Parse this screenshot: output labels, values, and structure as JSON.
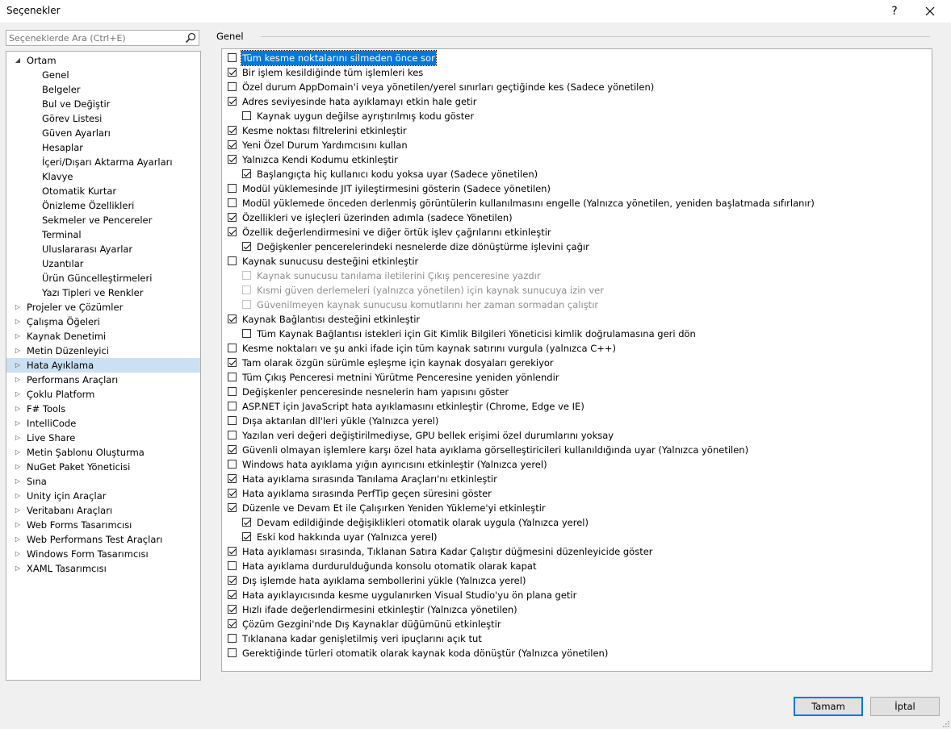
{
  "window": {
    "title": "Seçenekler",
    "help_label": "?"
  },
  "search": {
    "placeholder": "Seçeneklerde Ara (Ctrl+E)"
  },
  "tree": [
    {
      "label": "Ortam",
      "level": 0,
      "expanded": true
    },
    {
      "label": "Genel",
      "level": 1
    },
    {
      "label": "Belgeler",
      "level": 1
    },
    {
      "label": "Bul ve Değiştir",
      "level": 1
    },
    {
      "label": "Görev Listesi",
      "level": 1
    },
    {
      "label": "Güven Ayarları",
      "level": 1
    },
    {
      "label": "Hesaplar",
      "level": 1
    },
    {
      "label": "İçeri/Dışarı Aktarma Ayarları",
      "level": 1
    },
    {
      "label": "Klavye",
      "level": 1
    },
    {
      "label": "Otomatik Kurtar",
      "level": 1
    },
    {
      "label": "Önizleme Özellikleri",
      "level": 1
    },
    {
      "label": "Sekmeler ve Pencereler",
      "level": 1
    },
    {
      "label": "Terminal",
      "level": 1
    },
    {
      "label": "Uluslararası Ayarlar",
      "level": 1
    },
    {
      "label": "Uzantılar",
      "level": 1
    },
    {
      "label": "Ürün Güncelleştirmeleri",
      "level": 1
    },
    {
      "label": "Yazı Tipleri ve Renkler",
      "level": 1
    },
    {
      "label": "Projeler ve Çözümler",
      "level": 0,
      "expanded": false
    },
    {
      "label": "Çalışma Öğeleri",
      "level": 0,
      "expanded": false
    },
    {
      "label": "Kaynak Denetimi",
      "level": 0,
      "expanded": false
    },
    {
      "label": "Metin Düzenleyici",
      "level": 0,
      "expanded": false
    },
    {
      "label": "Hata Ayıklama",
      "level": 0,
      "expanded": false,
      "selected": true
    },
    {
      "label": "Performans Araçları",
      "level": 0,
      "expanded": false
    },
    {
      "label": "Çoklu Platform",
      "level": 0,
      "expanded": false
    },
    {
      "label": "F# Tools",
      "level": 0,
      "expanded": false
    },
    {
      "label": "IntelliCode",
      "level": 0,
      "expanded": false
    },
    {
      "label": "Live Share",
      "level": 0,
      "expanded": false
    },
    {
      "label": "Metin Şablonu Oluşturma",
      "level": 0,
      "expanded": false
    },
    {
      "label": "NuGet Paket Yöneticisi",
      "level": 0,
      "expanded": false
    },
    {
      "label": "Sına",
      "level": 0,
      "expanded": false
    },
    {
      "label": "Unity için Araçlar",
      "level": 0,
      "expanded": false
    },
    {
      "label": "Veritabanı Araçları",
      "level": 0,
      "expanded": false
    },
    {
      "label": "Web Forms Tasarımcısı",
      "level": 0,
      "expanded": false
    },
    {
      "label": "Web Performans Test Araçları",
      "level": 0,
      "expanded": false
    },
    {
      "label": "Windows Form Tasarımcısı",
      "level": 0,
      "expanded": false
    },
    {
      "label": "XAML Tasarımcısı",
      "level": 0,
      "expanded": false
    }
  ],
  "section": {
    "title": "Genel"
  },
  "options": [
    {
      "label": "Tüm kesme noktalarını silmeden önce sor",
      "checked": false,
      "indent": 0,
      "focused": true
    },
    {
      "label": "Bir işlem kesildiğinde tüm işlemleri kes",
      "checked": true,
      "indent": 0
    },
    {
      "label": "Özel durum AppDomain'i veya yönetilen/yerel sınırları geçtiğinde kes (Sadece yönetilen)",
      "checked": false,
      "indent": 0
    },
    {
      "label": "Adres seviyesinde hata ayıklamayı etkin hale getir",
      "checked": true,
      "indent": 0
    },
    {
      "label": "Kaynak uygun değilse ayrıştırılmış kodu göster",
      "checked": false,
      "indent": 1
    },
    {
      "label": "Kesme noktası filtrelerini etkinleştir",
      "checked": true,
      "indent": 0
    },
    {
      "label": "Yeni Özel Durum Yardımcısını kullan",
      "checked": true,
      "indent": 0
    },
    {
      "label": "Yalnızca Kendi Kodumu etkinleştir",
      "checked": true,
      "indent": 0
    },
    {
      "label": "Başlangıçta hiç kullanıcı kodu yoksa uyar (Sadece yönetilen)",
      "checked": true,
      "indent": 1
    },
    {
      "label": "Modül yüklemesinde JIT iyileştirmesini gösterin (Sadece yönetilen)",
      "checked": false,
      "indent": 0
    },
    {
      "label": "Modül yüklemede önceden derlenmiş görüntülerin kullanılmasını engelle (Yalnızca yönetilen, yeniden başlatmada sıfırlanır)",
      "checked": false,
      "indent": 0
    },
    {
      "label": "Özellikleri ve işleçleri üzerinden adımla (sadece Yönetilen)",
      "checked": true,
      "indent": 0
    },
    {
      "label": "Özellik değerlendirmesini ve diğer örtük işlev çağrılarını etkinleştir",
      "checked": true,
      "indent": 0
    },
    {
      "label": "Değişkenler pencerelerindeki nesnelerde dize dönüştürme işlevini çağır",
      "checked": true,
      "indent": 1
    },
    {
      "label": "Kaynak sunucusu desteğini etkinleştir",
      "checked": false,
      "indent": 0
    },
    {
      "label": "Kaynak sunucusu tanılama iletilerini Çıkış penceresine yazdır",
      "checked": false,
      "indent": 1,
      "disabled": true
    },
    {
      "label": "Kısmi güven derlemeleri (yalnızca yönetilen) için kaynak sunucuya izin ver",
      "checked": false,
      "indent": 1,
      "disabled": true
    },
    {
      "label": "Güvenilmeyen kaynak sunucusu komutlarını her zaman sormadan çalıştır",
      "checked": false,
      "indent": 1,
      "disabled": true
    },
    {
      "label": "Kaynak Bağlantısı desteğini etkinleştir",
      "checked": true,
      "indent": 0
    },
    {
      "label": "Tüm Kaynak Bağlantısı istekleri için Git Kimlik Bilgileri Yöneticisi kimlik doğrulamasına geri dön",
      "checked": false,
      "indent": 1
    },
    {
      "label": "Kesme noktaları ve şu anki ifade için tüm kaynak satırını vurgula (yalnızca C++)",
      "checked": false,
      "indent": 0
    },
    {
      "label": "Tam olarak özgün sürümle eşleşme için kaynak dosyaları gerekiyor",
      "checked": true,
      "indent": 0
    },
    {
      "label": "Tüm Çıkış Penceresi metnini Yürütme Penceresine yeniden yönlendir",
      "checked": false,
      "indent": 0
    },
    {
      "label": "Değişkenler penceresinde nesnelerin ham yapısını göster",
      "checked": false,
      "indent": 0
    },
    {
      "label": "ASP.NET için JavaScript hata ayıklamasını etkinleştir (Chrome, Edge ve IE)",
      "checked": false,
      "indent": 0
    },
    {
      "label": "Dışa aktarılan dll'leri yükle (Yalnızca yerel)",
      "checked": false,
      "indent": 0
    },
    {
      "label": "Yazılan veri değeri değiştirilmediyse, GPU bellek erişimi özel durumlarını yoksay",
      "checked": false,
      "indent": 0
    },
    {
      "label": "Güvenli olmayan işlemlere karşı özel hata ayıklama görselleştiricileri kullanıldığında uyar (Yalnızca yönetilen)",
      "checked": true,
      "indent": 0
    },
    {
      "label": "Windows hata ayıklama yığın ayırıcısını etkinleştir (Yalnızca yerel)",
      "checked": false,
      "indent": 0
    },
    {
      "label": "Hata ayıklama sırasında Tanılama Araçları'nı etkinleştir",
      "checked": true,
      "indent": 0
    },
    {
      "label": "Hata ayıklama sırasında PerfTip geçen süresini göster",
      "checked": true,
      "indent": 0
    },
    {
      "label": "Düzenle ve Devam Et ile Çalışırken Yeniden Yükleme'yi etkinleştir",
      "checked": true,
      "indent": 0
    },
    {
      "label": "Devam edildiğinde değişiklikleri otomatik olarak uygula (Yalnızca yerel)",
      "checked": true,
      "indent": 1
    },
    {
      "label": "Eski kod hakkında uyar (Yalnızca yerel)",
      "checked": true,
      "indent": 1
    },
    {
      "label": "Hata ayıklaması sırasında, Tıklanan Satıra Kadar Çalıştır düğmesini düzenleyicide göster",
      "checked": true,
      "indent": 0
    },
    {
      "label": "Hata ayıklama durdurulduğunda konsolu otomatik olarak kapat",
      "checked": false,
      "indent": 0
    },
    {
      "label": "Dış işlemde hata ayıklama sembollerini yükle (Yalnızca yerel)",
      "checked": true,
      "indent": 0
    },
    {
      "label": "Hata ayıklayıcısında kesme uygulanırken Visual Studio'yu ön plana getir",
      "checked": true,
      "indent": 0
    },
    {
      "label": "Hızlı ifade değerlendirmesini etkinleştir (Yalnızca yönetilen)",
      "checked": true,
      "indent": 0
    },
    {
      "label": "Çözüm Gezgini'nde Dış Kaynaklar düğümünü etkinleştir",
      "checked": true,
      "indent": 0
    },
    {
      "label": "Tıklanana kadar genişletilmiş veri ipuçlarını açık tut",
      "checked": false,
      "indent": 0
    },
    {
      "label": "Gerektiğinde türleri otomatik olarak kaynak koda dönüştür (Yalnızca yönetilen)",
      "checked": false,
      "indent": 0
    }
  ],
  "buttons": {
    "ok": "Tamam",
    "cancel": "İptal"
  }
}
